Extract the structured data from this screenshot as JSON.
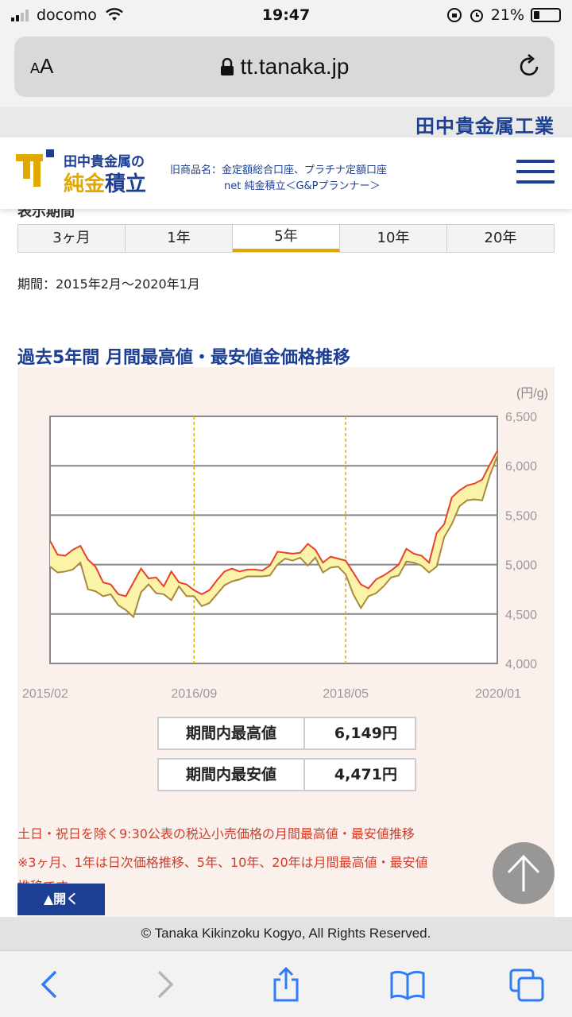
{
  "status_bar": {
    "carrier": "docomo",
    "time": "19:47",
    "battery": "21%"
  },
  "browser": {
    "text_size_label_small": "A",
    "text_size_label_large": "A",
    "url": "tt.tanaka.jp"
  },
  "site": {
    "corporate_name": "田中貴金属工業",
    "brand_small": "田中貴金属の",
    "brand_big_a": "純金",
    "brand_big_b": "積立",
    "old_names_line1": "旧商品名：金定額総合口座、プラチナ定額口座",
    "old_names_line2": "net 純金積立＜G&Pプランナー＞"
  },
  "period": {
    "label": "表示期間",
    "tabs": [
      {
        "label": "3ヶ月",
        "active": false
      },
      {
        "label": "1年",
        "active": false
      },
      {
        "label": "5年",
        "active": true
      },
      {
        "label": "10年",
        "active": false
      },
      {
        "label": "20年",
        "active": false
      }
    ],
    "range_text": "期間：2015年2月〜2020年1月"
  },
  "chart_title": "過去5年間 月間最高値・最安値金価格推移",
  "stats": {
    "max_label": "期間内最高値",
    "max_value": "6,149円",
    "min_label": "期間内最安値",
    "min_value": "4,471円"
  },
  "notes": {
    "line1": "土日・祝日を除く9:30公表の税込小売価格の月間最高値・最安値推移",
    "line2": "※3ヶ月、1年は日次価格推移、5年、10年、20年は月間最高値・最安値",
    "line3": "推移です。"
  },
  "open_button": "▲開く",
  "footer": "© Tanaka Kikinzoku Kogyo, All Rights Reserved.",
  "colors": {
    "brand_blue": "#1c3f94",
    "gold": "#e0a800",
    "high_line": "#e8412a",
    "low_line": "#a88a3c",
    "band_fill": "#faf3a8"
  },
  "chart_data": {
    "type": "line",
    "unit": "(円/g)",
    "ylim": [
      4000,
      6500
    ],
    "yticks": [
      "6,500",
      "6,000",
      "5,500",
      "5,000",
      "4,500",
      "4,000"
    ],
    "xtick_labels": [
      "2015/02",
      "2016/09",
      "2018/05",
      "2020/01"
    ],
    "xtick_index": [
      0,
      19,
      39,
      59
    ],
    "series": [
      {
        "values": [
          5240,
          5100,
          5090,
          5150,
          5190,
          5050,
          4980,
          4820,
          4800,
          4700,
          4680,
          4820,
          4960,
          4860,
          4870,
          4780,
          4930,
          4820,
          4800,
          4740,
          4700,
          4740,
          4840,
          4930,
          4960,
          4930,
          4950,
          4950,
          4940,
          4990,
          5130,
          5120,
          5110,
          5120,
          5210,
          5150,
          5020,
          5080,
          5060,
          5040,
          4920,
          4800,
          4760,
          4850,
          4890,
          4940,
          5000,
          5160,
          5110,
          5090,
          5020,
          5320,
          5410,
          5680,
          5750,
          5800,
          5820,
          5860,
          6010,
          6149
        ]
      },
      {
        "values": [
          4980,
          4920,
          4930,
          4950,
          5020,
          4750,
          4730,
          4680,
          4700,
          4590,
          4540,
          4471,
          4720,
          4800,
          4710,
          4700,
          4640,
          4780,
          4680,
          4680,
          4580,
          4610,
          4700,
          4790,
          4830,
          4850,
          4880,
          4880,
          4880,
          4890,
          5000,
          5060,
          5040,
          5070,
          4990,
          5070,
          4920,
          4970,
          4980,
          4900,
          4700,
          4560,
          4680,
          4710,
          4780,
          4870,
          4890,
          5030,
          5020,
          4990,
          4920,
          4980,
          5280,
          5410,
          5590,
          5650,
          5660,
          5650,
          5900,
          6100
        ]
      }
    ]
  }
}
